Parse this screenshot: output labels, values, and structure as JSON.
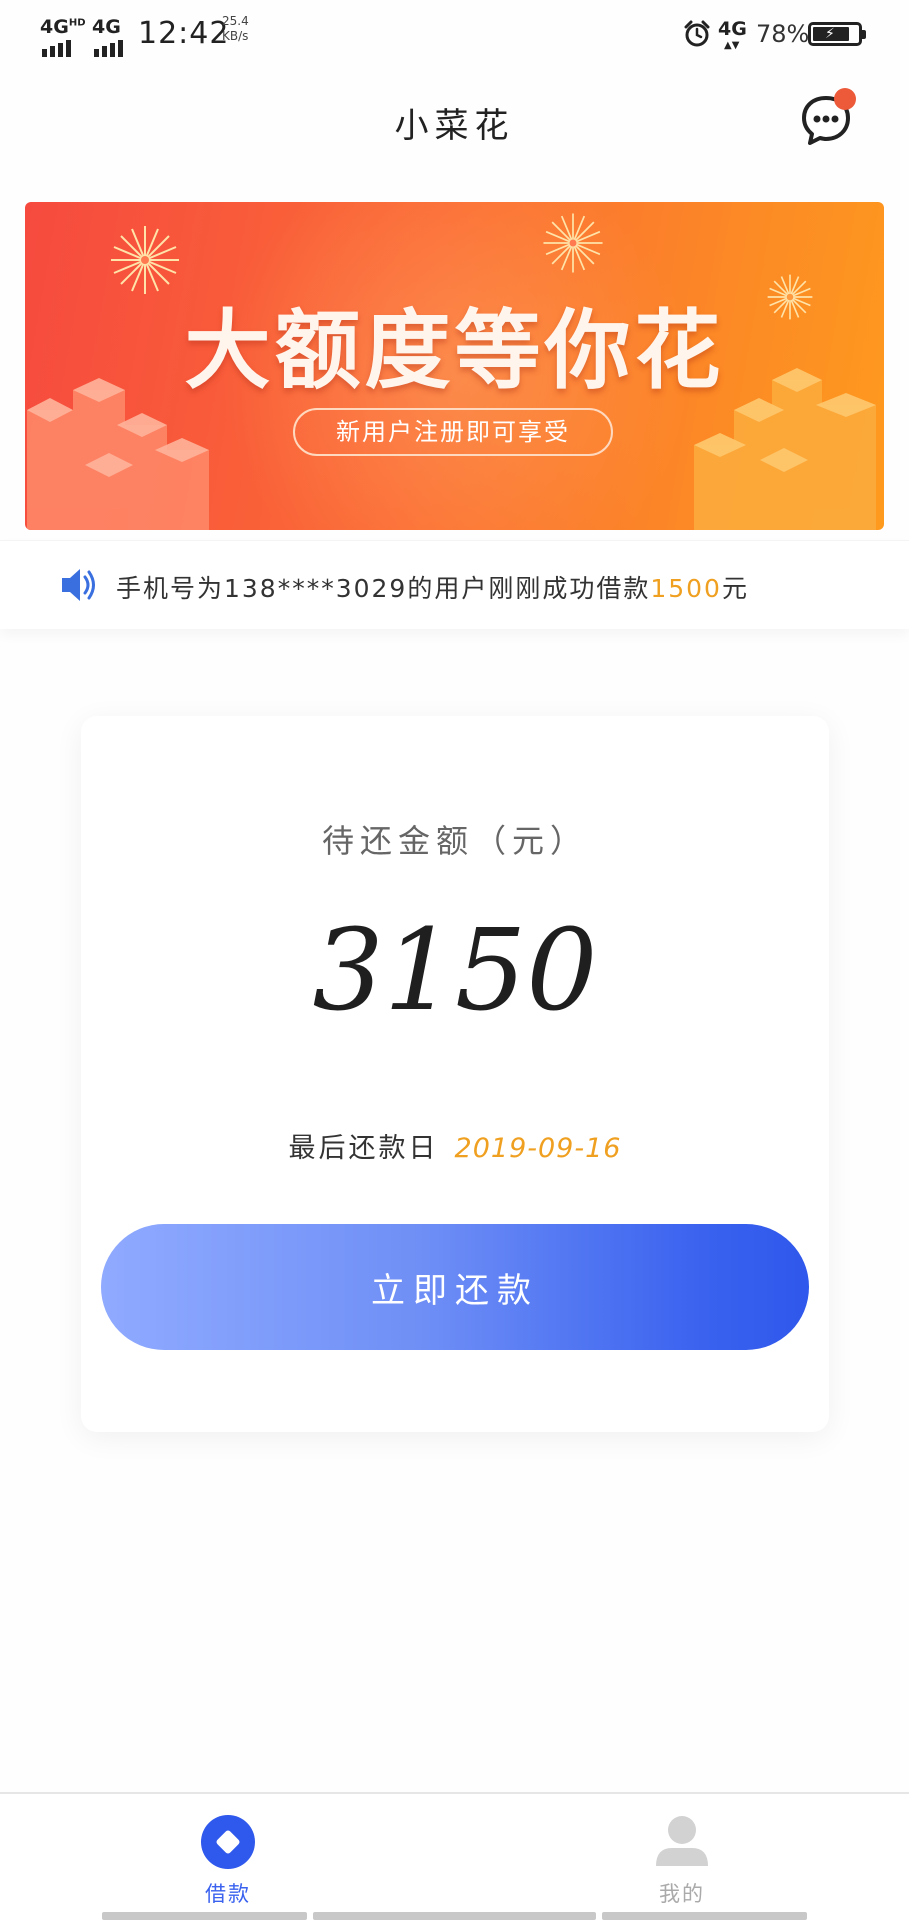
{
  "status_bar": {
    "net_left_1": "4G",
    "net_left_1_sup": "HD",
    "net_left_2": "4G",
    "time": "12:42",
    "speed_value": "25.4",
    "speed_unit": "KB/s",
    "net_right": "4G",
    "battery_percent": "78%"
  },
  "header": {
    "title": "小菜花",
    "message_icon": "chat-bubble-icon",
    "has_unread": true
  },
  "banner": {
    "headline": "大额度等你花",
    "pill_text": "新用户注册即可享受"
  },
  "notice": {
    "icon": "speaker-icon",
    "text_prefix": "手机号为138****3029的用户刚刚成功借款",
    "amount": "1500",
    "unit": "元"
  },
  "repay_card": {
    "label": "待还金额（元）",
    "amount": "3150",
    "due_label": "最后还款日",
    "due_date": "2019-09-16",
    "button_label": "立即还款"
  },
  "tabs": [
    {
      "label": "借款",
      "icon": "borrow-diamond-icon",
      "active": true
    },
    {
      "label": "我的",
      "icon": "profile-icon",
      "active": false
    }
  ],
  "colors": {
    "accent_blue": "#3a62ef",
    "highlight_orange": "#f0a020",
    "banner_red": "#f64a3f",
    "badge_red": "#ec5a3a"
  }
}
